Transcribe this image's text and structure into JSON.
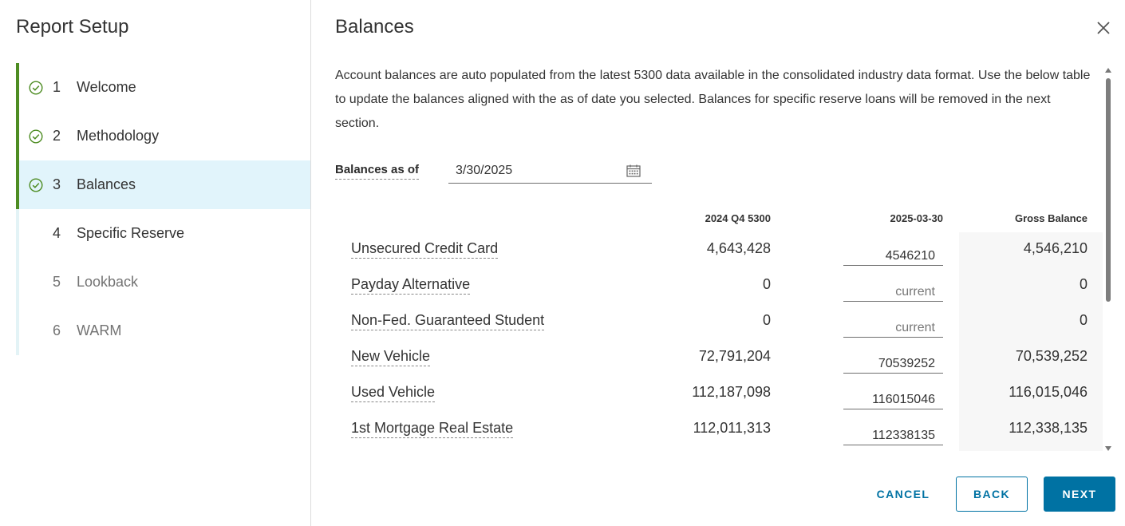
{
  "sidebar": {
    "title": "Report Setup",
    "steps": [
      {
        "num": "1",
        "label": "Welcome",
        "complete": true
      },
      {
        "num": "2",
        "label": "Methodology",
        "complete": true
      },
      {
        "num": "3",
        "label": "Balances",
        "complete": true,
        "active": true
      },
      {
        "num": "4",
        "label": "Specific Reserve",
        "complete": false
      },
      {
        "num": "5",
        "label": "Lookback",
        "complete": false,
        "disabled": true
      },
      {
        "num": "6",
        "label": "WARM",
        "complete": false,
        "disabled": true
      }
    ]
  },
  "main": {
    "title": "Balances",
    "description": "Account balances are auto populated from the latest 5300 data available in the consolidated industry data format. Use the below table to update the balances aligned with the as of date you selected. Balances for specific reserve loans will be removed in the next section.",
    "asof_label": "Balances as of",
    "asof_value": "3/30/2025",
    "columns": {
      "prev": "2024 Q4 5300",
      "current": "2025-03-30",
      "gross": "Gross Balance"
    },
    "rows": [
      {
        "name": "Unsecured Credit Card",
        "prev": "4,643,428",
        "current": "4546210",
        "placeholder": "",
        "gross": "4,546,210"
      },
      {
        "name": "Payday Alternative",
        "prev": "0",
        "current": "",
        "placeholder": "current",
        "gross": "0"
      },
      {
        "name": "Non-Fed. Guaranteed Student",
        "prev": "0",
        "current": "",
        "placeholder": "current",
        "gross": "0"
      },
      {
        "name": "New Vehicle",
        "prev": "72,791,204",
        "current": "70539252",
        "placeholder": "",
        "gross": "70,539,252"
      },
      {
        "name": "Used Vehicle",
        "prev": "112,187,098",
        "current": "116015046",
        "placeholder": "",
        "gross": "116,015,046"
      },
      {
        "name": "1st Mortgage Real Estate",
        "prev": "112,011,313",
        "current": "112338135",
        "placeholder": "",
        "gross": "112,338,135"
      }
    ]
  },
  "footer": {
    "cancel_label": "CANCEL",
    "back_label": "BACK",
    "next_label": "NEXT"
  },
  "colors": {
    "accent": "#0072a3",
    "complete": "#4d8c22",
    "active_bg": "#e1f4fb"
  },
  "icons": {
    "step_complete": "check-circle-icon",
    "close": "close-icon",
    "calendar": "calendar-icon"
  }
}
